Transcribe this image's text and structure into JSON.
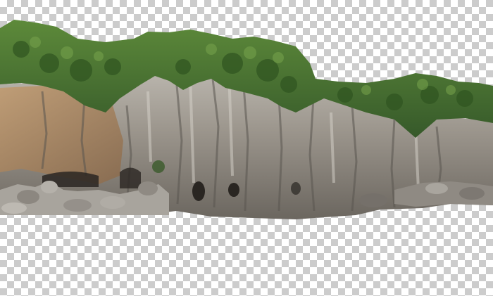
{
  "canvas": {
    "background": "transparency-checkerboard",
    "checker_colors": [
      "#ffffff",
      "#cccccc"
    ]
  },
  "subject": {
    "description_icon": "cliff-cutout",
    "colors": {
      "rock_light": "#b8b4ac",
      "rock_mid": "#8f8a82",
      "rock_dark": "#5e5a55",
      "rock_warm": "#a4805c",
      "vegetation": "#4f7a32",
      "vegetation_dark": "#2f5420",
      "cave": "#2a2622"
    }
  }
}
